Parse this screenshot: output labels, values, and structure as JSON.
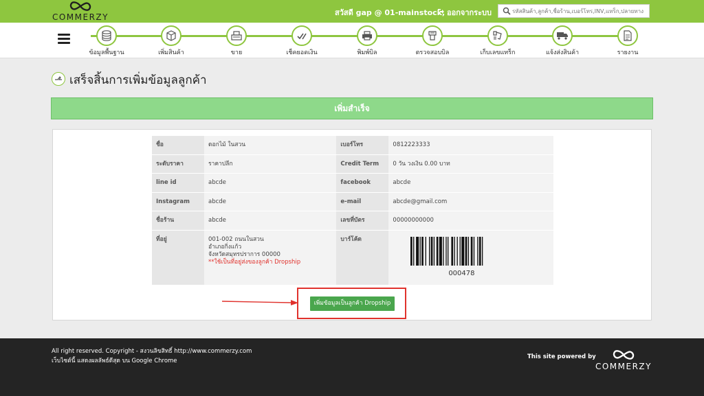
{
  "header": {
    "logo_text": "COMMERZY",
    "greeting": "สวัสดี gap @ 01-mainstock,",
    "logout": "ออกจากระบบ",
    "search_placeholder": "รหัสสินค้า,ลูกค้า,ชื่อร้าน,เบอร์โทร,INV,แทร็ก,ปลายทาง"
  },
  "nav": [
    {
      "label": "ข้อมูลพื้นฐาน",
      "icon": "database-icon"
    },
    {
      "label": "เพิ่มสินค้า",
      "icon": "box-icon"
    },
    {
      "label": "ขาย",
      "icon": "cash-register-icon"
    },
    {
      "label": "เช็คยอดเงิน",
      "icon": "checkmark-pen-icon"
    },
    {
      "label": "พิมพ์บิล",
      "icon": "printer-icon"
    },
    {
      "label": "ตรวจสอบบิล",
      "icon": "scanner-icon"
    },
    {
      "label": "เก็บเลขแทร็ก",
      "icon": "barcode-scanner-icon"
    },
    {
      "label": "แจ้งส่งสินค้า",
      "icon": "truck-icon"
    },
    {
      "label": "รายงาน",
      "icon": "report-icon"
    }
  ],
  "page": {
    "title": "เสร็จสิ้นการเพิ่มข้อมูลลูกค้า",
    "success": "เพิ่มสำเร็จ"
  },
  "customer": {
    "name_label": "ชื่อ",
    "name": "ดอกไม้ ในสวน",
    "phone_label": "เบอร์โทร",
    "phone": "0812223333",
    "price_label": "ระดับราคา",
    "price": "ราคาปลีก",
    "credit_label": "Credit Term",
    "credit": "0 วัน วงเงิน 0.00 บาท",
    "line_label": "line id",
    "line": "abcde",
    "facebook_label": "facebook",
    "facebook": "abcde",
    "instagram_label": "Instagram",
    "instagram": "abcde",
    "email_label": "e-mail",
    "email": "abcde@gmail.com",
    "shop_label": "ชื่อร้าน",
    "shop": "abcde",
    "card_label": "เลขที่บัตร",
    "card": "00000000000",
    "address_label": "ที่อยู่",
    "address_1": "001-002 ถนนในสวน",
    "address_2": "อำเภอกิ่งแก้ว",
    "address_3": "จังหวัดสมุทรปราการ 00000",
    "address_note": "**ใช้เป็นที่อยู่ส่งของลูกค้า Dropship",
    "barcode_label": "บาร์โค้ด",
    "barcode_number": "000478"
  },
  "actions": {
    "dropship_button": "เพิ่มข้อมูลเป็นลูกค้า Dropship"
  },
  "footer": {
    "copyright": "All right reserved. Copyright - สงวนลิขสิทธิ์ http://www.commerzy.com",
    "browser_note": "เว็บไซต์นี้ แสดงผลลัพธ์ดีสุด บน Google Chrome",
    "powered": "This site powered by",
    "logo_text": "COMMERZY"
  },
  "colors": {
    "brand_green": "#8ec63f",
    "success_green": "#8ed98a",
    "button_green": "#4aa64d",
    "highlight_red": "#e0312c",
    "footer_bg": "#242424"
  }
}
